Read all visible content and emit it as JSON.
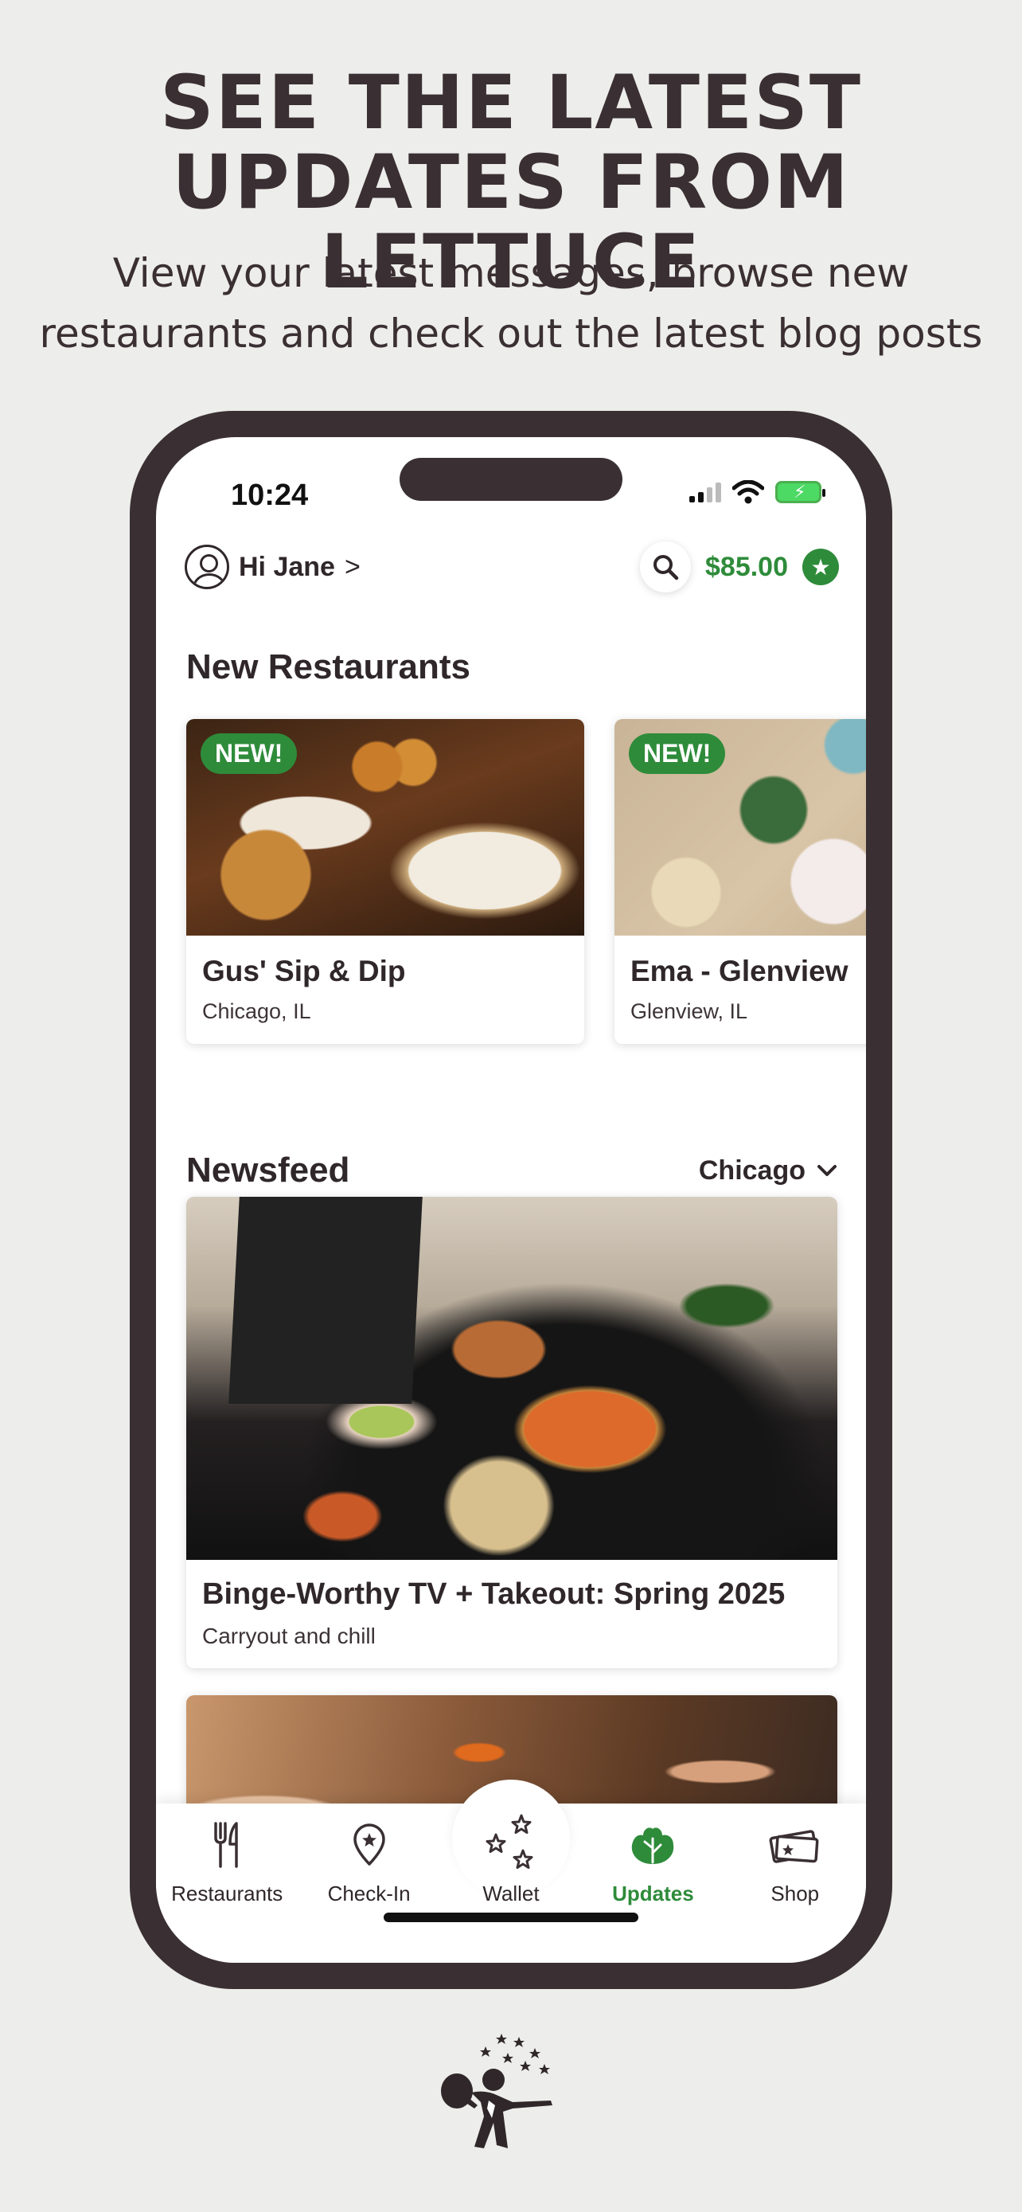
{
  "promo": {
    "headline_line1": "SEE THE LATEST",
    "headline_line2": "UPDATES FROM LETTUCE",
    "subhead_line1": "View your latest messages, browse new",
    "subhead_line2": "restaurants and check out the latest blog posts"
  },
  "status_bar": {
    "time": "10:24"
  },
  "header": {
    "greeting": "Hi Jane",
    "chevron": ">",
    "balance": "$85.00"
  },
  "new_restaurants": {
    "title": "New Restaurants",
    "items": [
      {
        "badge": "NEW!",
        "name": "Gus' Sip & Dip",
        "location": "Chicago, IL"
      },
      {
        "badge": "NEW!",
        "name": "Ema - Glenview",
        "location": "Glenview, IL"
      }
    ]
  },
  "newsfeed": {
    "title": "Newsfeed",
    "city": "Chicago",
    "posts": [
      {
        "title": "Binge-Worthy TV + Takeout: Spring 2025",
        "subtitle": "Carryout and chill"
      }
    ]
  },
  "tabbar": {
    "items": [
      {
        "label": "Restaurants",
        "icon": "fork-knife-icon"
      },
      {
        "label": "Check-In",
        "icon": "location-pin-icon"
      },
      {
        "label": "Wallet",
        "icon": "stars-icon"
      },
      {
        "label": "Updates",
        "icon": "lettuce-icon",
        "active": true
      },
      {
        "label": "Shop",
        "icon": "gift-card-icon"
      }
    ]
  },
  "colors": {
    "accent": "#2e8b3a",
    "frame": "#3a3033",
    "background": "#ededeb"
  }
}
